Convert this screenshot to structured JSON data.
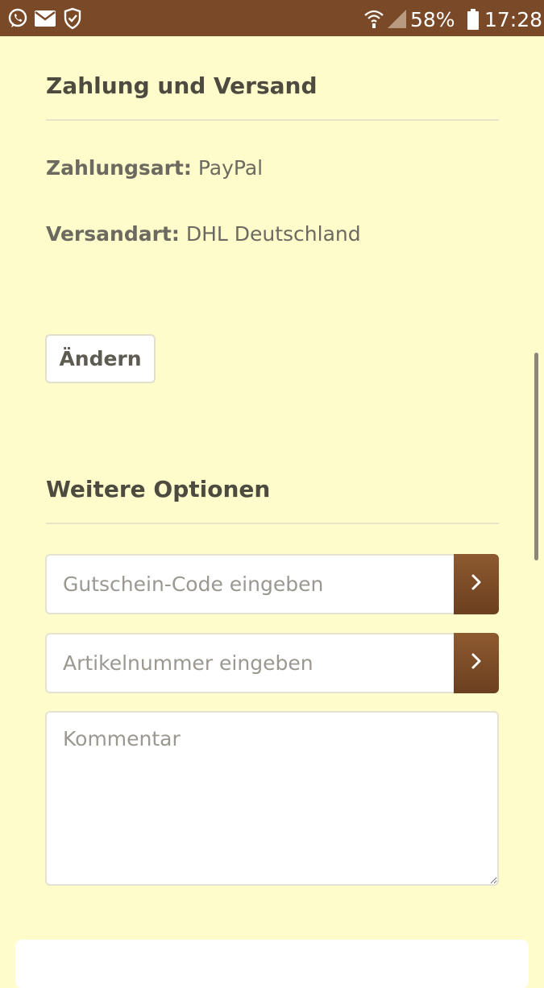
{
  "status_bar": {
    "battery": "58%",
    "time": "17:28",
    "icons": [
      "whatsapp-icon",
      "mail-icon",
      "shield-check-icon",
      "wifi-icon",
      "signal-icon",
      "battery-icon"
    ]
  },
  "payment_shipping": {
    "title": "Zahlung und Versand",
    "payment_label": "Zahlungsart:",
    "payment_value": "PayPal",
    "shipping_label": "Versandart:",
    "shipping_value": "DHL Deutschland",
    "change_button": "Ändern"
  },
  "more_options": {
    "title": "Weitere Optionen",
    "voucher_placeholder": "Gutschein-Code eingeben",
    "article_placeholder": "Artikelnummer eingeben",
    "comment_placeholder": "Kommentar"
  },
  "colors": {
    "status_bar": "#7a4a28",
    "page_background": "#fefccb",
    "accent_button": "#7b4a26",
    "heading_text": "#4d4a40"
  }
}
